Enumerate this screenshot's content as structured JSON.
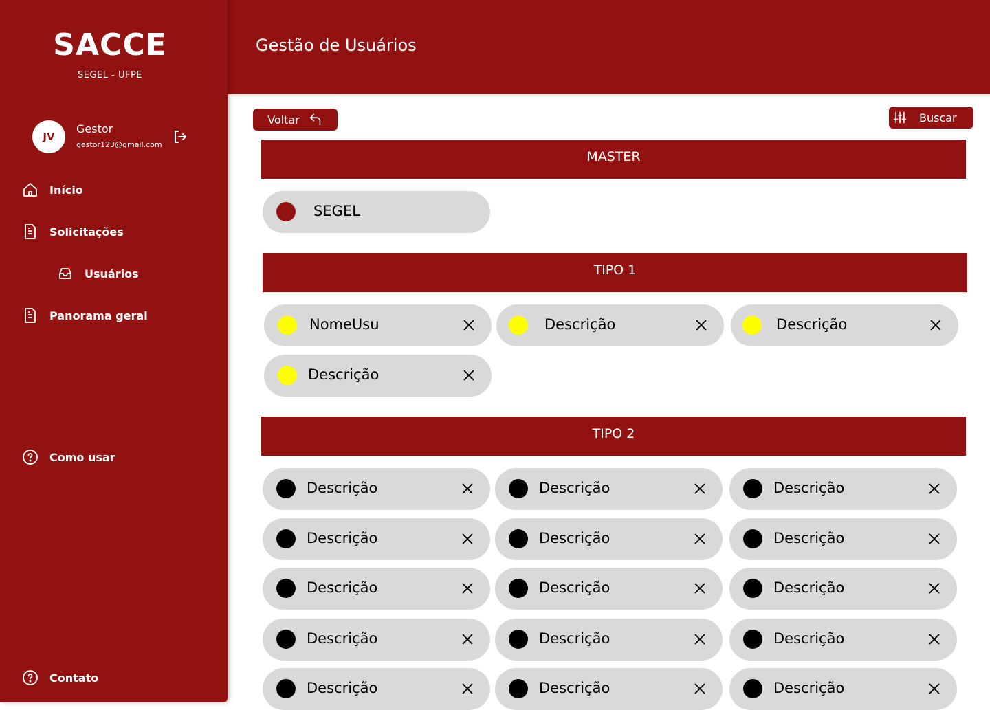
{
  "app": {
    "name": "SACCE",
    "subtitle": "SEGEL - UFPE"
  },
  "header": {
    "title": "Gestão de Usuários"
  },
  "user": {
    "initials": "JV",
    "name": "Gestor",
    "email": "gestor123@gmail.com"
  },
  "nav": {
    "inicio": "Início",
    "solicitacoes": "Solicitações",
    "usuarios": "Usuários",
    "panorama": "Panorama geral",
    "como_usar": "Como usar",
    "contato": "Contato"
  },
  "toolbar": {
    "back_label": "Voltar",
    "search_label": "Buscar"
  },
  "colors": {
    "brand": "#921111",
    "chip_bg": "#d9d9d9",
    "master_dot": "#921111",
    "tipo1_dot": "#ffff00",
    "tipo2_dot": "#000000"
  },
  "sections": {
    "master": {
      "title": "MASTER",
      "items": [
        "SEGEL"
      ]
    },
    "tipo1": {
      "title": "TIPO 1",
      "items": [
        "NomeUsu",
        "Descrição",
        "Descrição",
        "Descrição"
      ]
    },
    "tipo2": {
      "title": "TIPO 2",
      "items": [
        "Descrição",
        "Descrição",
        "Descrição",
        "Descrição",
        "Descrição",
        "Descrição",
        "Descrição",
        "Descrição",
        "Descrição",
        "Descrição",
        "Descrição",
        "Descrição",
        "Descrição",
        "Descrição",
        "Descrição"
      ]
    }
  }
}
